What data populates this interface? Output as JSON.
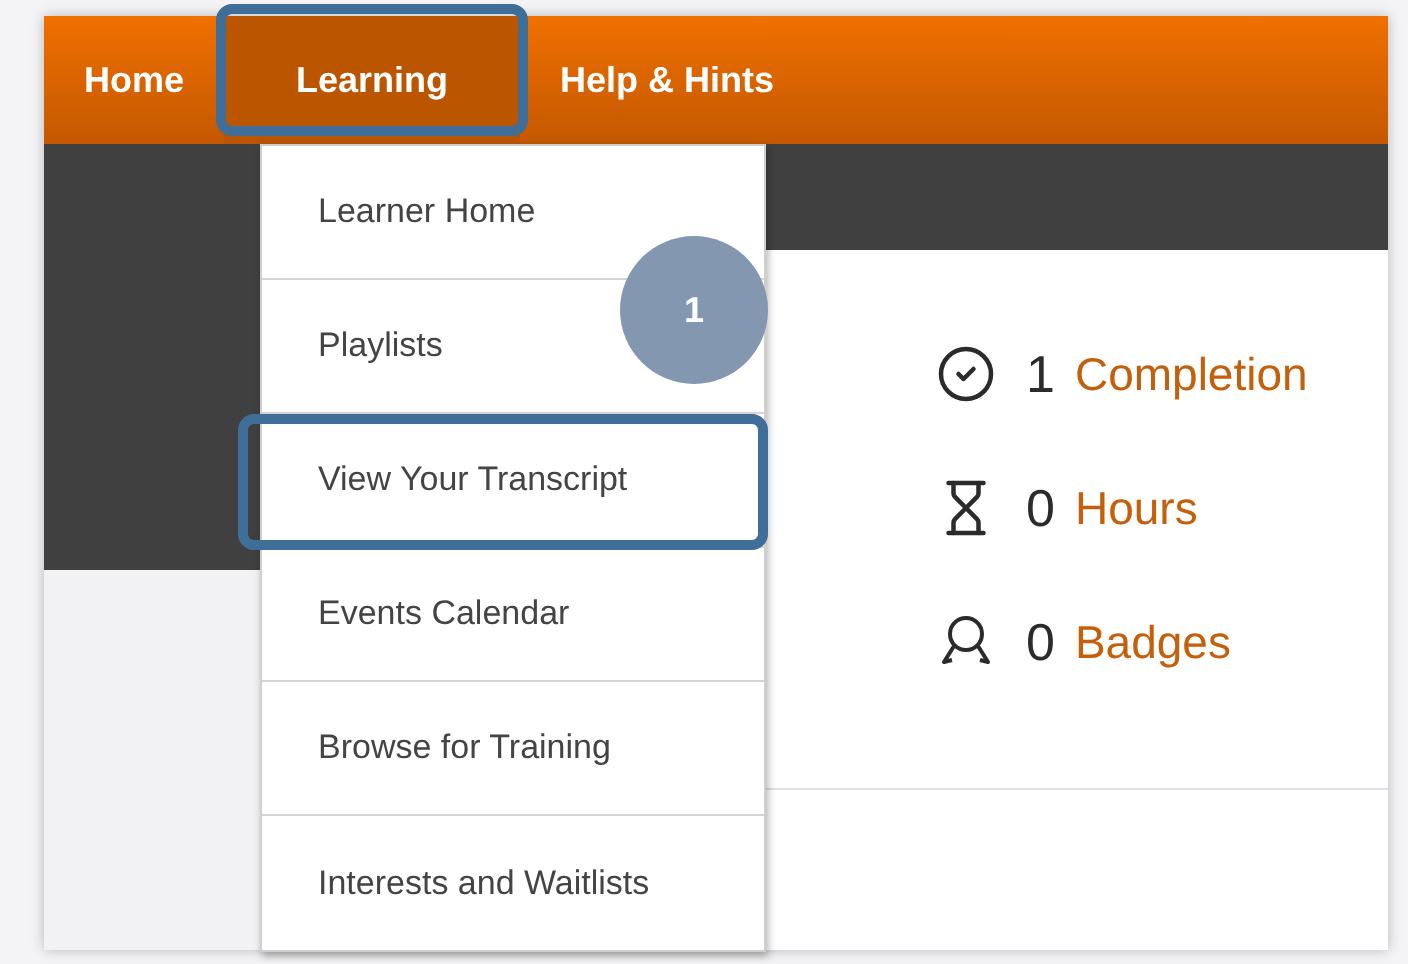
{
  "nav": [
    {
      "label": "Home",
      "selected": false,
      "highlighted": false
    },
    {
      "label": "Learning",
      "selected": true,
      "highlighted": true
    },
    {
      "label": "Help & Hints",
      "selected": false,
      "highlighted": false
    }
  ],
  "dropdown": [
    {
      "label": "Learner Home",
      "highlighted": false
    },
    {
      "label": "Playlists",
      "highlighted": false
    },
    {
      "label": "View Your Transcript",
      "highlighted": true
    },
    {
      "label": "Events Calendar",
      "highlighted": false
    },
    {
      "label": "Browse for Training",
      "highlighted": false
    },
    {
      "label": "Interests and Waitlists",
      "highlighted": false
    }
  ],
  "callout": {
    "number": "1"
  },
  "stats": [
    {
      "kind": "completion",
      "count": "1",
      "label": "Completion"
    },
    {
      "kind": "hours",
      "count": "0",
      "label": "Hours"
    },
    {
      "kind": "badges",
      "count": "0",
      "label": "Badges"
    }
  ]
}
